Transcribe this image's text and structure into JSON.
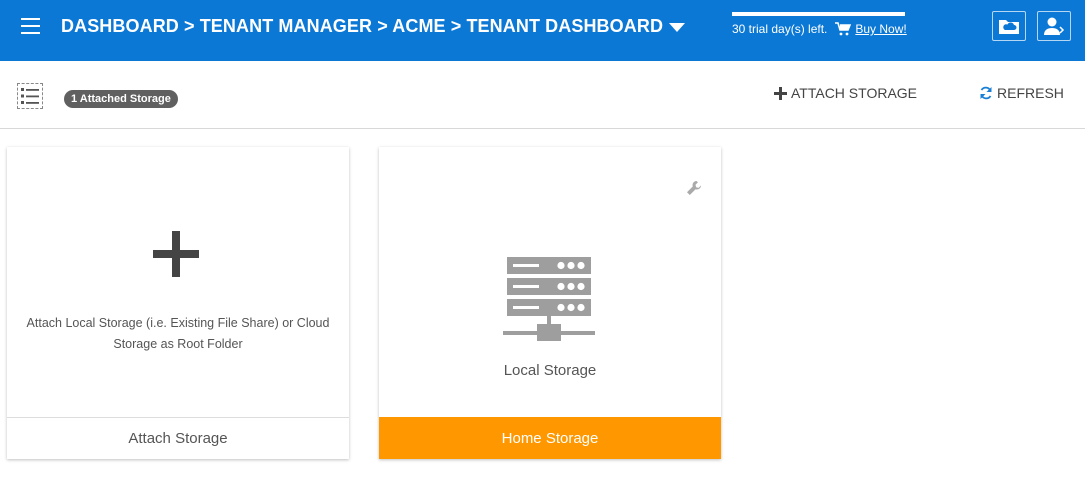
{
  "header": {
    "breadcrumb": "DASHBOARD > TENANT MANAGER > ACME > TENANT DASHBOARD",
    "trial_text": "30 trial day(s) left.",
    "buy_now": "Buy Now!",
    "accent_color": "#0c78d6"
  },
  "toolbar": {
    "badge": "1 Attached Storage",
    "attach_label": "ATTACH STORAGE",
    "refresh_label": "REFRESH"
  },
  "cards": {
    "attach": {
      "description": "Attach Local Storage (i.e. Existing File Share) or Cloud Storage as Root Folder",
      "footer": "Attach Storage"
    },
    "home": {
      "name": "Local Storage",
      "footer": "Home Storage",
      "footer_color": "#ff9800"
    }
  },
  "icons": [
    "menu-icon",
    "caret-down-icon",
    "cart-icon",
    "cloud-folder-icon",
    "user-icon",
    "list-view-icon",
    "plus-icon",
    "refresh-icon",
    "wrench-icon",
    "server-icon"
  ]
}
